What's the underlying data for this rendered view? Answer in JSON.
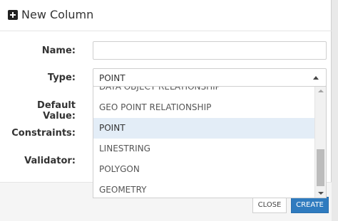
{
  "dialog": {
    "title": "New Column",
    "icon": "plus-square-icon"
  },
  "form": {
    "name_label": "Name:",
    "name_value": "",
    "type_label": "Type:",
    "type_value": "POINT",
    "default_label": "Default Value:",
    "constraints_label": "Constraints:",
    "validator_label": "Validator:"
  },
  "dropdown": {
    "options": [
      "DATA OBJECT RELATIONSHIP",
      "GEO POINT RELATIONSHIP",
      "POINT",
      "LINESTRING",
      "POLYGON",
      "GEOMETRY"
    ],
    "selected": "POINT"
  },
  "footer": {
    "close_label": "CLOSE",
    "create_label": "CREATE"
  },
  "colors": {
    "primary": "#2f7bbf",
    "selected_option_bg": "#e3edf7"
  }
}
